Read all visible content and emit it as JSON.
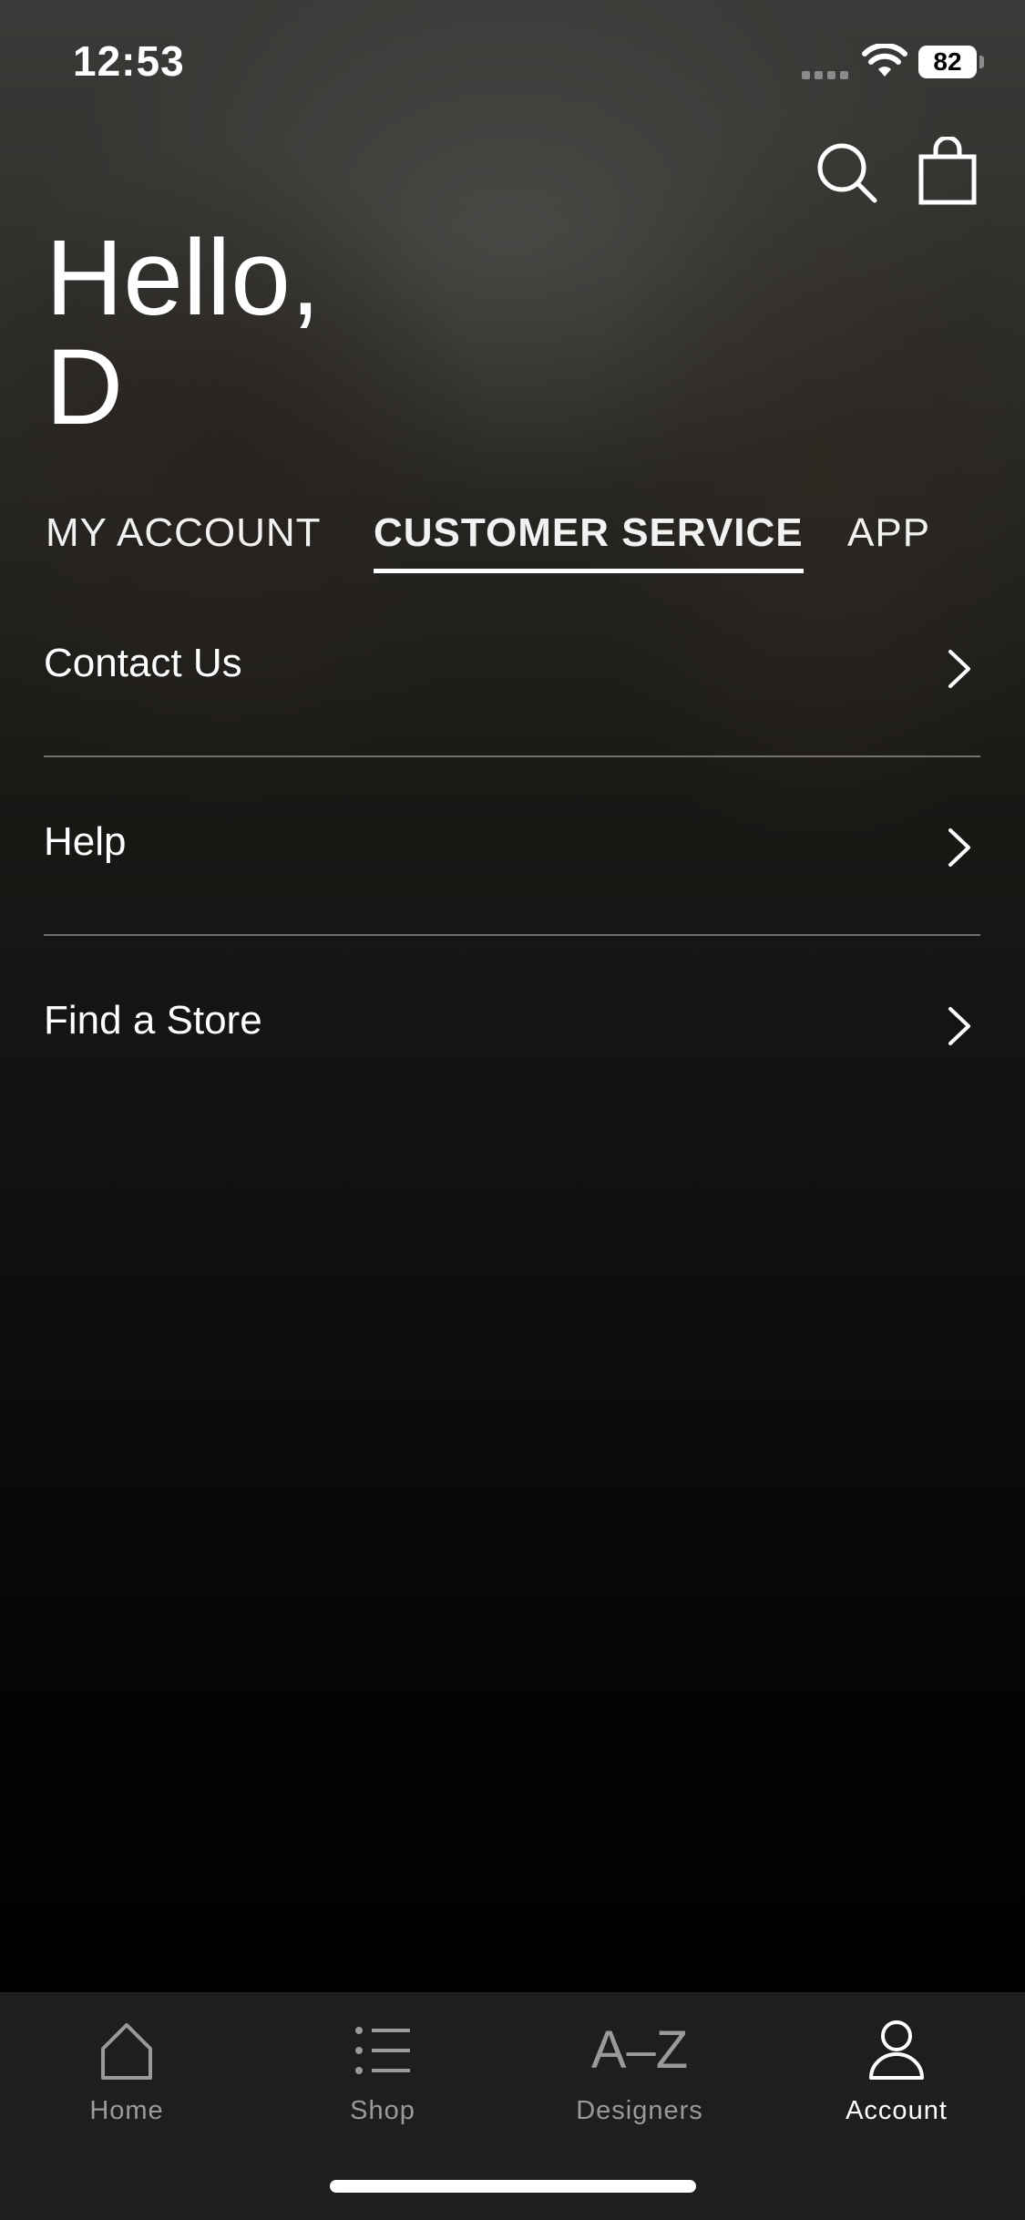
{
  "status_bar": {
    "time": "12:53",
    "battery": "82",
    "icons": [
      "signal-icon",
      "wifi-icon",
      "battery-icon"
    ]
  },
  "header": {
    "icons": [
      "search-icon",
      "bag-icon"
    ]
  },
  "greeting": {
    "line1": "Hello,",
    "line2": "D"
  },
  "tabs": [
    {
      "label": "MY ACCOUNT",
      "active": false
    },
    {
      "label": "CUSTOMER SERVICE",
      "active": true
    },
    {
      "label": "APP",
      "active": false
    }
  ],
  "menu": [
    {
      "label": "Contact Us",
      "icon": "chevron-right-icon"
    },
    {
      "label": "Help",
      "icon": "chevron-right-icon"
    },
    {
      "label": "Find a Store",
      "icon": "chevron-right-icon"
    }
  ],
  "tab_bar": [
    {
      "label": "Home",
      "icon": "home-icon",
      "active": false
    },
    {
      "label": "Shop",
      "icon": "list-icon",
      "active": false
    },
    {
      "label": "Designers",
      "icon_text": "A–Z",
      "active": false
    },
    {
      "label": "Account",
      "icon": "person-icon",
      "active": true
    }
  ],
  "colors": {
    "text": "#ffffff",
    "inactive_tab_bar_label": "#9a9a9a",
    "tab_bar_background": "#1e1e1e",
    "divider": "#8c8c8c"
  }
}
